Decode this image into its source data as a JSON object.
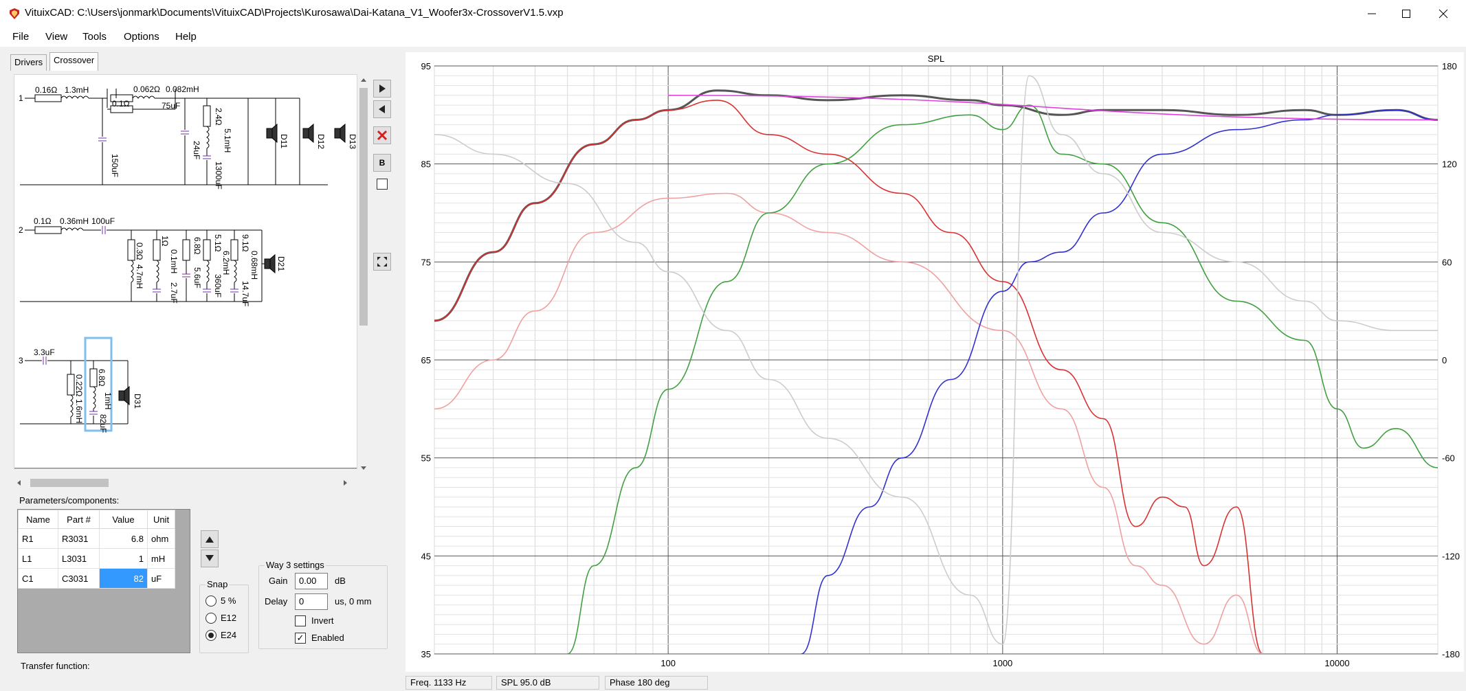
{
  "window": {
    "title": "VituixCAD: C:\\Users\\jonmark\\Documents\\VituixCAD\\Projects\\Kurosawa\\Dai-Katana_V1_Woofer3x-CrossoverV1.5.vxp",
    "icon": "vituixcad-logo-icon"
  },
  "menu": [
    "File",
    "View",
    "Tools",
    "Options",
    "Help"
  ],
  "tabs": [
    "Drivers",
    "Crossover"
  ],
  "schematic": {
    "way1": {
      "number": "1",
      "labels": [
        "0.16Ω",
        "1.3mH",
        "0.062Ω",
        "0.082mH",
        "0.1Ω",
        "75uF",
        "150uF",
        "24uF",
        "2.4Ω",
        "5.1mH",
        "1300uF",
        "D11",
        "D12",
        "D13"
      ]
    },
    "way2": {
      "number": "2",
      "labels": [
        "0.1Ω",
        "0.36mH",
        "100uF",
        "0.3Ω",
        "4.7mH",
        "1Ω",
        "0.1mH",
        "2.7uF",
        "6.8Ω",
        "5.6uF",
        "5.1Ω",
        "6.2mH",
        "360uF",
        "9.1Ω",
        "0.68mH",
        "14.7uF",
        "D21"
      ]
    },
    "way3": {
      "number": "3",
      "labels": [
        "3.3uF",
        "0.22Ω",
        "1.6mH",
        "6.8Ω",
        "1mH",
        "82uF",
        "D31"
      ]
    }
  },
  "side_buttons": {
    "b_label": "B"
  },
  "params": {
    "label": "Parameters/components:",
    "columns": [
      "Name",
      "Part #",
      "Value",
      "Unit"
    ],
    "rows": [
      {
        "name": "R1",
        "part": "R3031",
        "value": "6.8",
        "unit": "ohm"
      },
      {
        "name": "L1",
        "part": "L3031",
        "value": "1",
        "unit": "mH"
      },
      {
        "name": "C1",
        "part": "C3031",
        "value": "82",
        "unit": "uF"
      }
    ]
  },
  "snap": {
    "title": "Snap",
    "options": [
      "5 %",
      "E12",
      "E24"
    ],
    "selected": "E24"
  },
  "way_settings": {
    "title": "Way 3 settings",
    "gain_label": "Gain",
    "gain_value": "0.00",
    "gain_unit": "dB",
    "delay_label": "Delay",
    "delay_value": "0",
    "delay_unit": "us, 0 mm",
    "invert_label": "Invert",
    "invert_checked": false,
    "enabled_label": "Enabled",
    "enabled_checked": true
  },
  "transfer_label": "Transfer function:",
  "graph": {
    "title": "SPL",
    "y_left_ticks": [
      "95",
      "85",
      "75",
      "65",
      "55",
      "45",
      "35"
    ],
    "y_right_ticks": [
      "180",
      "120",
      "60",
      "0",
      "-60",
      "-120",
      "-180"
    ],
    "x_ticks": [
      "100",
      "1000",
      "10000"
    ]
  },
  "chart_data": {
    "type": "line",
    "title": "SPL",
    "x_scale": "log",
    "xlim": [
      20,
      20000
    ],
    "ylim": [
      35,
      95
    ],
    "y2lim": [
      -180,
      180
    ],
    "grid": true,
    "series": [
      {
        "color": "#555555",
        "x": [
          20,
          30,
          40,
          60,
          80,
          100,
          140,
          200,
          300,
          500,
          800,
          1000,
          1500,
          2000,
          3000,
          5000,
          8000,
          10000,
          15000,
          20000
        ],
        "y": [
          69,
          76,
          81,
          87,
          89.5,
          90.5,
          92.5,
          92,
          91.5,
          92,
          91.5,
          91,
          90,
          90.5,
          90.5,
          90,
          90.5,
          90,
          90.5,
          89.5
        ]
      },
      {
        "color": "#d93030",
        "x": [
          20,
          30,
          40,
          60,
          80,
          100,
          140,
          200,
          300,
          500,
          700,
          1000,
          1500,
          2000,
          2500,
          3000,
          3500,
          4000,
          5000,
          6000
        ],
        "y": [
          69,
          76,
          81,
          87,
          89.5,
          90.5,
          91.5,
          88,
          86,
          82,
          78,
          73,
          64,
          59,
          48,
          51,
          50,
          44,
          50,
          35
        ]
      },
      {
        "color": "#f0a0a0",
        "x": [
          20,
          30,
          40,
          60,
          100,
          150,
          200,
          300,
          500,
          1000,
          1500,
          2000,
          2500,
          3000,
          4000,
          5000,
          6000
        ],
        "y": [
          60,
          65,
          70,
          78,
          81.5,
          82,
          80,
          78,
          75,
          68,
          60,
          52,
          44,
          42,
          36,
          41,
          35
        ]
      },
      {
        "color": "#40a040",
        "x": [
          50,
          60,
          80,
          100,
          150,
          200,
          300,
          500,
          800,
          1000,
          1200,
          1500,
          2000,
          3000,
          5000,
          8000,
          10000,
          12000,
          15000,
          20000
        ],
        "y": [
          35,
          44,
          54,
          62,
          73,
          80,
          85,
          89,
          90,
          88.5,
          91,
          86,
          85,
          79,
          71,
          67,
          60,
          56,
          58,
          54
        ]
      },
      {
        "color": "#3030d0",
        "x": [
          250,
          300,
          400,
          500,
          700,
          1000,
          1200,
          1500,
          2000,
          3000,
          5000,
          8000,
          10000,
          15000,
          20000
        ],
        "y": [
          35,
          43,
          50,
          55,
          63,
          72,
          75,
          76,
          80,
          86,
          88.5,
          89.5,
          90,
          90.5,
          89.5
        ]
      },
      {
        "color": "#cccccc",
        "x": [
          20,
          30,
          50,
          80,
          100,
          150,
          200,
          300,
          500,
          800,
          1000,
          1200,
          1500,
          2000,
          3000,
          5000,
          8000,
          10000,
          15000,
          20000
        ],
        "y": [
          88,
          86,
          83,
          77,
          74,
          68,
          63,
          57,
          51,
          41,
          36,
          94,
          88,
          84,
          78,
          75,
          71,
          69,
          68,
          68
        ]
      },
      {
        "color": "#e040e0",
        "x": [
          100,
          20000
        ],
        "y": [
          92,
          89.5
        ]
      }
    ]
  },
  "status": {
    "freq": "Freq.  1133 Hz",
    "spl": "SPL  95.0 dB",
    "phase": "Phase   180 deg"
  },
  "colors": {
    "grid": "#aaaaaa",
    "total": "#555555",
    "woofer": "#d93030",
    "mid": "#40a040",
    "tweeter": "#3030d0",
    "target": "#e040e0"
  }
}
